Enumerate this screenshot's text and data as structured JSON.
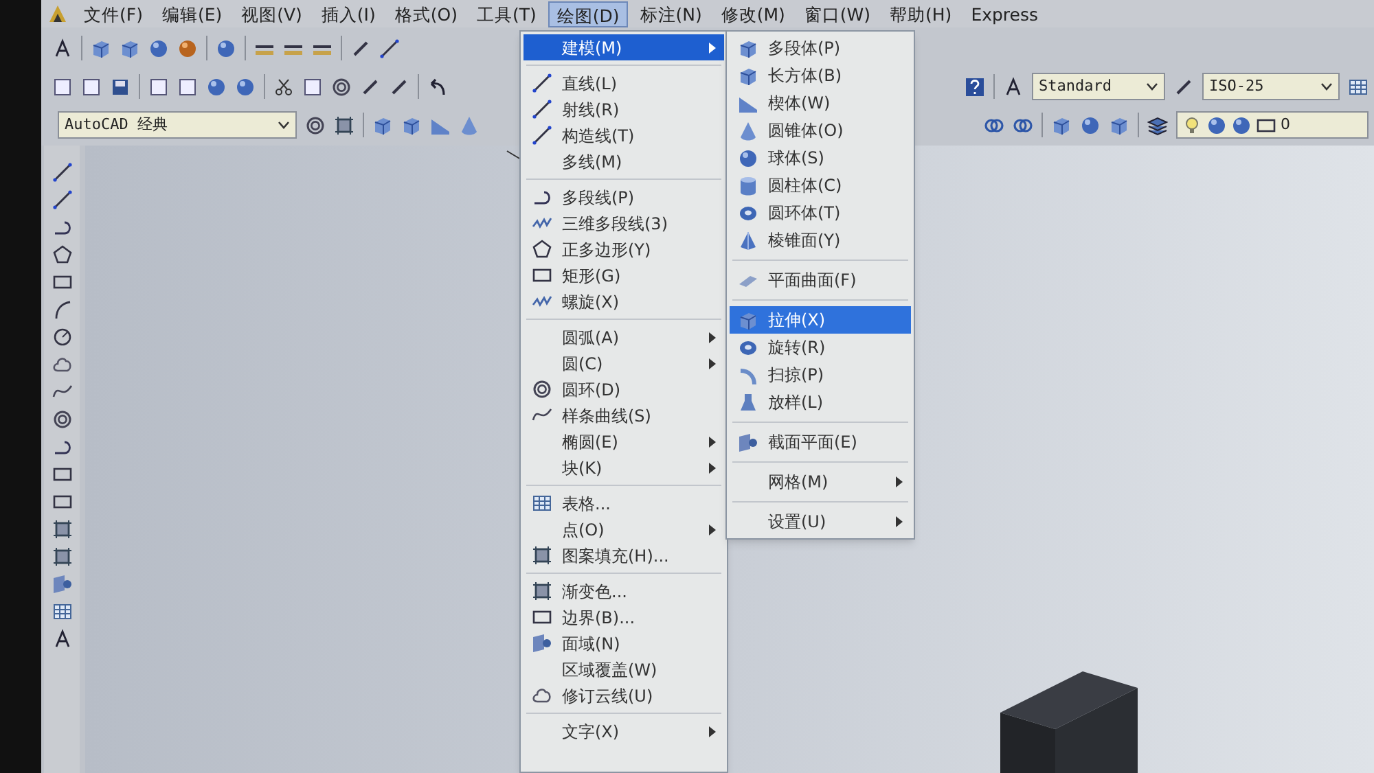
{
  "menu_bar": {
    "items": [
      {
        "label": "文件(F)",
        "selected": false
      },
      {
        "label": "编辑(E)",
        "selected": false
      },
      {
        "label": "视图(V)",
        "selected": false
      },
      {
        "label": "插入(I)",
        "selected": false
      },
      {
        "label": "格式(O)",
        "selected": false
      },
      {
        "label": "工具(T)",
        "selected": false
      },
      {
        "label": "绘图(D)",
        "selected": true
      },
      {
        "label": "标注(N)",
        "selected": false
      },
      {
        "label": "修改(M)",
        "selected": false
      },
      {
        "label": "窗口(W)",
        "selected": false
      },
      {
        "label": "帮助(H)",
        "selected": false
      },
      {
        "label": "Express",
        "selected": false
      }
    ]
  },
  "toolbars": {
    "workspace": {
      "value": "AutoCAD 经典"
    },
    "text_style": {
      "value": "Standard"
    },
    "dim_style": {
      "value": "ISO-25"
    },
    "layer": {
      "value": "0"
    }
  },
  "draw_menu": {
    "sections": [
      [
        {
          "label": "建模(M)",
          "has_submenu": true,
          "selected": true
        }
      ],
      [
        {
          "label": "直线(L)",
          "has_submenu": false,
          "selected": false
        },
        {
          "label": "射线(R)",
          "has_submenu": false,
          "selected": false
        },
        {
          "label": "构造线(T)",
          "has_submenu": false,
          "selected": false
        },
        {
          "label": "多线(M)",
          "has_submenu": false,
          "selected": false
        }
      ],
      [
        {
          "label": "多段线(P)",
          "has_submenu": false,
          "selected": false
        },
        {
          "label": "三维多段线(3)",
          "has_submenu": false,
          "selected": false
        },
        {
          "label": "正多边形(Y)",
          "has_submenu": false,
          "selected": false
        },
        {
          "label": "矩形(G)",
          "has_submenu": false,
          "selected": false
        },
        {
          "label": "螺旋(X)",
          "has_submenu": false,
          "selected": false
        }
      ],
      [
        {
          "label": "圆弧(A)",
          "has_submenu": true,
          "selected": false
        },
        {
          "label": "圆(C)",
          "has_submenu": true,
          "selected": false
        },
        {
          "label": "圆环(D)",
          "has_submenu": false,
          "selected": false
        },
        {
          "label": "样条曲线(S)",
          "has_submenu": false,
          "selected": false
        },
        {
          "label": "椭圆(E)",
          "has_submenu": true,
          "selected": false
        },
        {
          "label": "块(K)",
          "has_submenu": true,
          "selected": false
        }
      ],
      [
        {
          "label": "表格...",
          "has_submenu": false,
          "selected": false
        },
        {
          "label": "点(O)",
          "has_submenu": true,
          "selected": false
        },
        {
          "label": "图案填充(H)...",
          "has_submenu": false,
          "selected": false
        }
      ],
      [
        {
          "label": "渐变色...",
          "has_submenu": false,
          "selected": false
        },
        {
          "label": "边界(B)...",
          "has_submenu": false,
          "selected": false
        },
        {
          "label": "面域(N)",
          "has_submenu": false,
          "selected": false
        },
        {
          "label": "区域覆盖(W)",
          "has_submenu": false,
          "selected": false
        },
        {
          "label": "修订云线(U)",
          "has_submenu": false,
          "selected": false
        }
      ],
      [
        {
          "label": "文字(X)",
          "has_submenu": true,
          "selected": false
        }
      ]
    ]
  },
  "modeling_submenu": {
    "sections": [
      [
        {
          "label": "多段体(P)",
          "has_submenu": false,
          "selected": false
        },
        {
          "label": "长方体(B)",
          "has_submenu": false,
          "selected": false
        },
        {
          "label": "楔体(W)",
          "has_submenu": false,
          "selected": false
        },
        {
          "label": "圆锥体(O)",
          "has_submenu": false,
          "selected": false
        },
        {
          "label": "球体(S)",
          "has_submenu": false,
          "selected": false
        },
        {
          "label": "圆柱体(C)",
          "has_submenu": false,
          "selected": false
        },
        {
          "label": "圆环体(T)",
          "has_submenu": false,
          "selected": false
        },
        {
          "label": "棱锥面(Y)",
          "has_submenu": false,
          "selected": false
        }
      ],
      [
        {
          "label": "平面曲面(F)",
          "has_submenu": false,
          "selected": false
        }
      ],
      [
        {
          "label": "拉伸(X)",
          "has_submenu": false,
          "selected": true
        },
        {
          "label": "旋转(R)",
          "has_submenu": false,
          "selected": false
        },
        {
          "label": "扫掠(P)",
          "has_submenu": false,
          "selected": false
        },
        {
          "label": "放样(L)",
          "has_submenu": false,
          "selected": false
        }
      ],
      [
        {
          "label": "截面平面(E)",
          "has_submenu": false,
          "selected": false
        }
      ],
      [
        {
          "label": "网格(M)",
          "has_submenu": true,
          "selected": false
        }
      ],
      [
        {
          "label": "设置(U)",
          "has_submenu": true,
          "selected": false
        }
      ]
    ]
  }
}
